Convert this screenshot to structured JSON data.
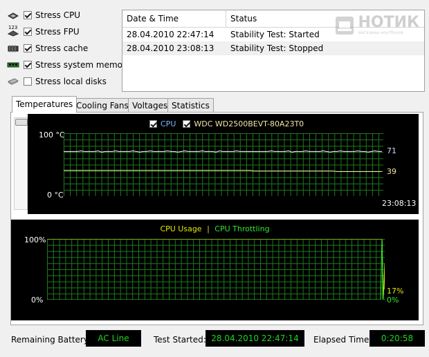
{
  "stress_options": [
    {
      "label": "Stress CPU",
      "checked": true,
      "icon": "cpu-chip-icon"
    },
    {
      "label": "Stress FPU",
      "checked": true,
      "icon": "fpu-icon"
    },
    {
      "label": "Stress cache",
      "checked": true,
      "icon": "cache-chip-icon"
    },
    {
      "label": "Stress system memory",
      "checked": true,
      "icon": "memory-module-icon"
    },
    {
      "label": "Stress local disks",
      "checked": false,
      "icon": "hard-disk-icon"
    }
  ],
  "fpu_icon_text": "123",
  "log": {
    "columns": [
      "Date & Time",
      "Status"
    ],
    "rows": [
      [
        "28.04.2010 22:47:14",
        "Stability Test: Started"
      ],
      [
        "28.04.2010 23:08:13",
        "Stability Test: Stopped"
      ]
    ]
  },
  "watermark": {
    "brand": "НОТИК",
    "tagline": "магазины ноутбуков"
  },
  "tabs": [
    "Temperatures",
    "Cooling Fans",
    "Voltages",
    "Statistics"
  ],
  "temp_graph": {
    "legend": [
      {
        "label": "CPU",
        "checked": true,
        "color": "#7fb3ff"
      },
      {
        "label": "WDC WD2500BEVT-80A23T0",
        "checked": true,
        "color": "#f5e6a8"
      }
    ],
    "y_top": "100 °C",
    "y_bottom": "0 °C",
    "time": "23:08:13",
    "series": [
      {
        "name": "CPU",
        "current": "71",
        "value": 71,
        "color": "#ffffff"
      },
      {
        "name": "WDC WD2500BEVT-80A23T0",
        "current": "39",
        "value": 39,
        "color": "#f5e6a8"
      }
    ]
  },
  "cpu_graph": {
    "legend_usage": "CPU Usage",
    "legend_sep": "|",
    "legend_throttle": "CPU Throttling",
    "usage_color": "#e6e600",
    "throttle_color": "#2ee82e",
    "y_top": "100%",
    "y_bottom": "0%",
    "usage_value": "17%",
    "usage_current": 17,
    "throttle_value": "0%",
    "throttle_current": 0
  },
  "status": {
    "battery_label": "Remaining Battery:",
    "battery_value": "AC Line",
    "started_label": "Test Started:",
    "started_value": "28.04.2010 22:47:14",
    "elapsed_label": "Elapsed Time:",
    "elapsed_value": "0:20:58"
  }
}
